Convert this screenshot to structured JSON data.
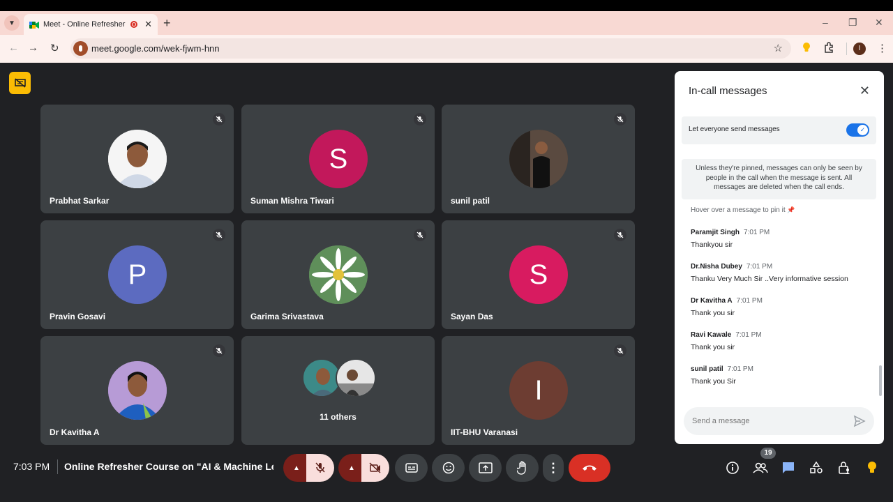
{
  "browser": {
    "tab_title": "Meet - Online Refresher Co",
    "new_tab": "+",
    "url": "meet.google.com/wek-fjwm-hnn",
    "window_controls": [
      "–",
      "❐",
      "✕"
    ],
    "profile_initial": "I"
  },
  "grid": {
    "tiles": [
      {
        "name": "Prabhat Sarkar",
        "avatar_letter": "",
        "avatar_color": "#e8e8e8"
      },
      {
        "name": "Suman Mishra Tiwari",
        "avatar_letter": "S",
        "avatar_color": "#c2185b"
      },
      {
        "name": "sunil patil",
        "avatar_letter": "",
        "avatar_color": "#3a3330"
      },
      {
        "name": "Pravin Gosavi",
        "avatar_letter": "P",
        "avatar_color": "#5c6bc0"
      },
      {
        "name": "Garima Srivastava",
        "avatar_letter": "",
        "avatar_color": "#7aa37a"
      },
      {
        "name": "Sayan Das",
        "avatar_letter": "S",
        "avatar_color": "#d81b60"
      },
      {
        "name": "Dr Kavitha A",
        "avatar_letter": "",
        "avatar_color": "#9c7ec2"
      },
      {
        "name": "11 others",
        "avatar_letter": "",
        "avatar_color": "#3c4043"
      },
      {
        "name": "IIT-BHU Varanasi",
        "avatar_letter": "I",
        "avatar_color": "#6d3d32"
      }
    ]
  },
  "panel": {
    "title": "In-call messages",
    "setting_label": "Let everyone send messages",
    "setting_on": true,
    "info": "Unless they're pinned, messages can only be seen by people in the call when the message is sent. All messages are deleted when the call ends.",
    "hint": "Hover over a message to pin it",
    "messages": [
      {
        "sender": "Paramjit Singh",
        "time": "7:01 PM",
        "text": "Thankyou sir"
      },
      {
        "sender": "Dr.Nisha Dubey",
        "time": "7:01 PM",
        "text": "Thanku Very Much Sir ..Very informative session"
      },
      {
        "sender": "Dr Kavitha A",
        "time": "7:01 PM",
        "text": "Thank you sir"
      },
      {
        "sender": "Ravi Kawale",
        "time": "7:01 PM",
        "text": "Thank you sir"
      },
      {
        "sender": "sunil patil",
        "time": "7:01 PM",
        "text": "Thank you Sir"
      }
    ],
    "composer_placeholder": "Send a message"
  },
  "bottom": {
    "clock": "7:03 PM",
    "meeting_title": "Online Refresher Course on \"AI & Machine Lea...",
    "participants_count": "19"
  },
  "colors": {
    "end_call": "#d93025",
    "accent": "#1a73e8",
    "stage_bg": "#202124"
  }
}
